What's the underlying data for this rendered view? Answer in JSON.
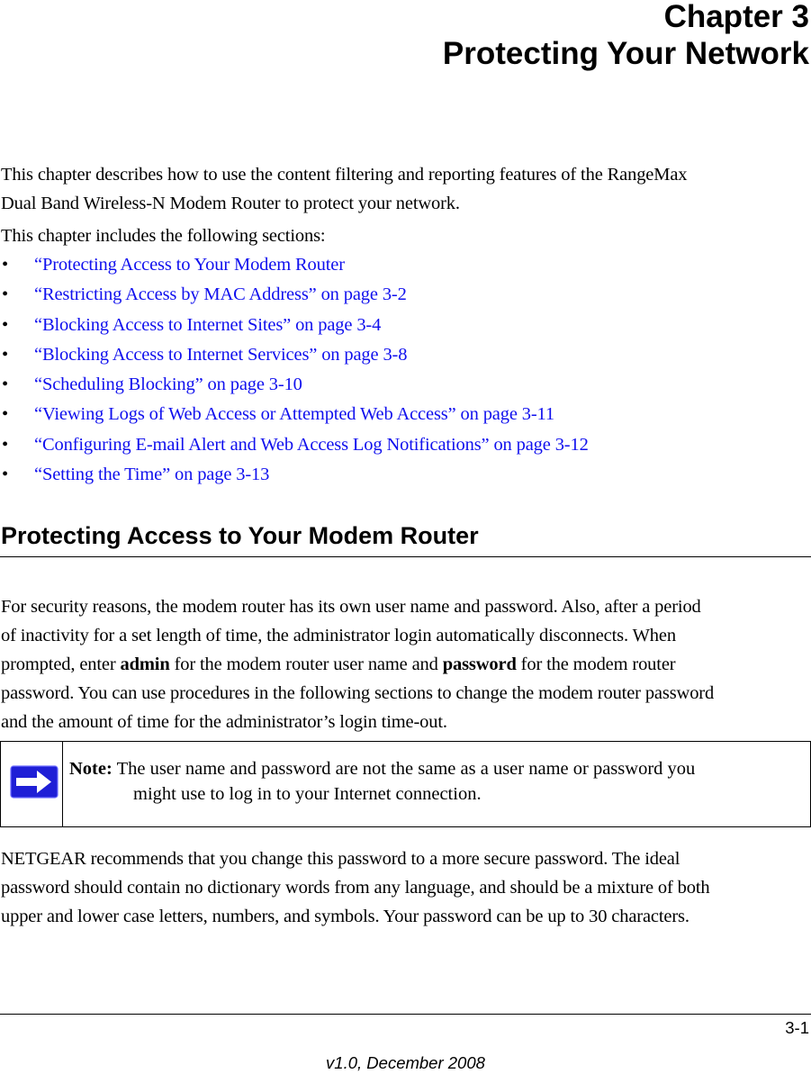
{
  "header": {
    "chapter_label": "Chapter 3",
    "chapter_title": "Protecting Your Network"
  },
  "intro": {
    "paragraph": "This chapter describes how to use the content filtering and reporting features of the RangeMax Dual Band Wireless-N Modem Router to protect your network.",
    "line1": "This chapter describes how to use the content filtering and reporting features of the RangeMax",
    "line2": "Dual Band Wireless-N Modem Router to protect your network.",
    "sections_lead": "This chapter includes the following sections:"
  },
  "toc": {
    "bullet": "•",
    "link_color": "#1010ee",
    "items": [
      {
        "label": "“Protecting Access to Your Modem Router"
      },
      {
        "label": "“Restricting Access by MAC Address” on page 3-2"
      },
      {
        "label": "“Blocking Access to Internet Sites” on page 3-4"
      },
      {
        "label": "“Blocking Access to Internet Services” on page 3-8"
      },
      {
        "label": "“Scheduling Blocking” on page 3-10"
      },
      {
        "label": "“Viewing Logs of Web Access or Attempted Web Access” on page 3-11"
      },
      {
        "label": "“Configuring E-mail Alert and Web Access Log Notifications” on page 3-12"
      },
      {
        "label": "“Setting the Time” on page 3-13"
      }
    ]
  },
  "section": {
    "heading": "Protecting Access to Your Modem Router",
    "para1": {
      "line1": "For security reasons, the modem router has its own user name and password. Also, after a period",
      "line2": "of inactivity for a set length of time, the administrator login automatically disconnects. When",
      "line3_pre": "prompted, enter ",
      "line3_bold1": "admin",
      "line3_mid": " for the modem router user name and ",
      "line3_bold2": "password",
      "line3_post": " for the modem router",
      "line4": "password. You can use procedures in the following sections to change the modem router password",
      "line5": "and the amount of time for the administrator’s login time-out."
    },
    "note": {
      "icon": "right-arrow-icon",
      "icon_color": "#1f1fd6",
      "label": "Note:",
      "line1": " The user name and password are not the same as a user name or password you",
      "line2": "might use to log in to your Internet connection."
    },
    "para2": {
      "line1": "NETGEAR recommends that you change this password to a more secure password. The ideal",
      "line2": "password should contain no dictionary words from any language, and should be a mixture of both",
      "line3": "upper and lower case letters, numbers, and symbols. Your password can be up to 30 characters."
    }
  },
  "footer": {
    "page_number": "3-1",
    "version": "v1.0, December 2008"
  }
}
